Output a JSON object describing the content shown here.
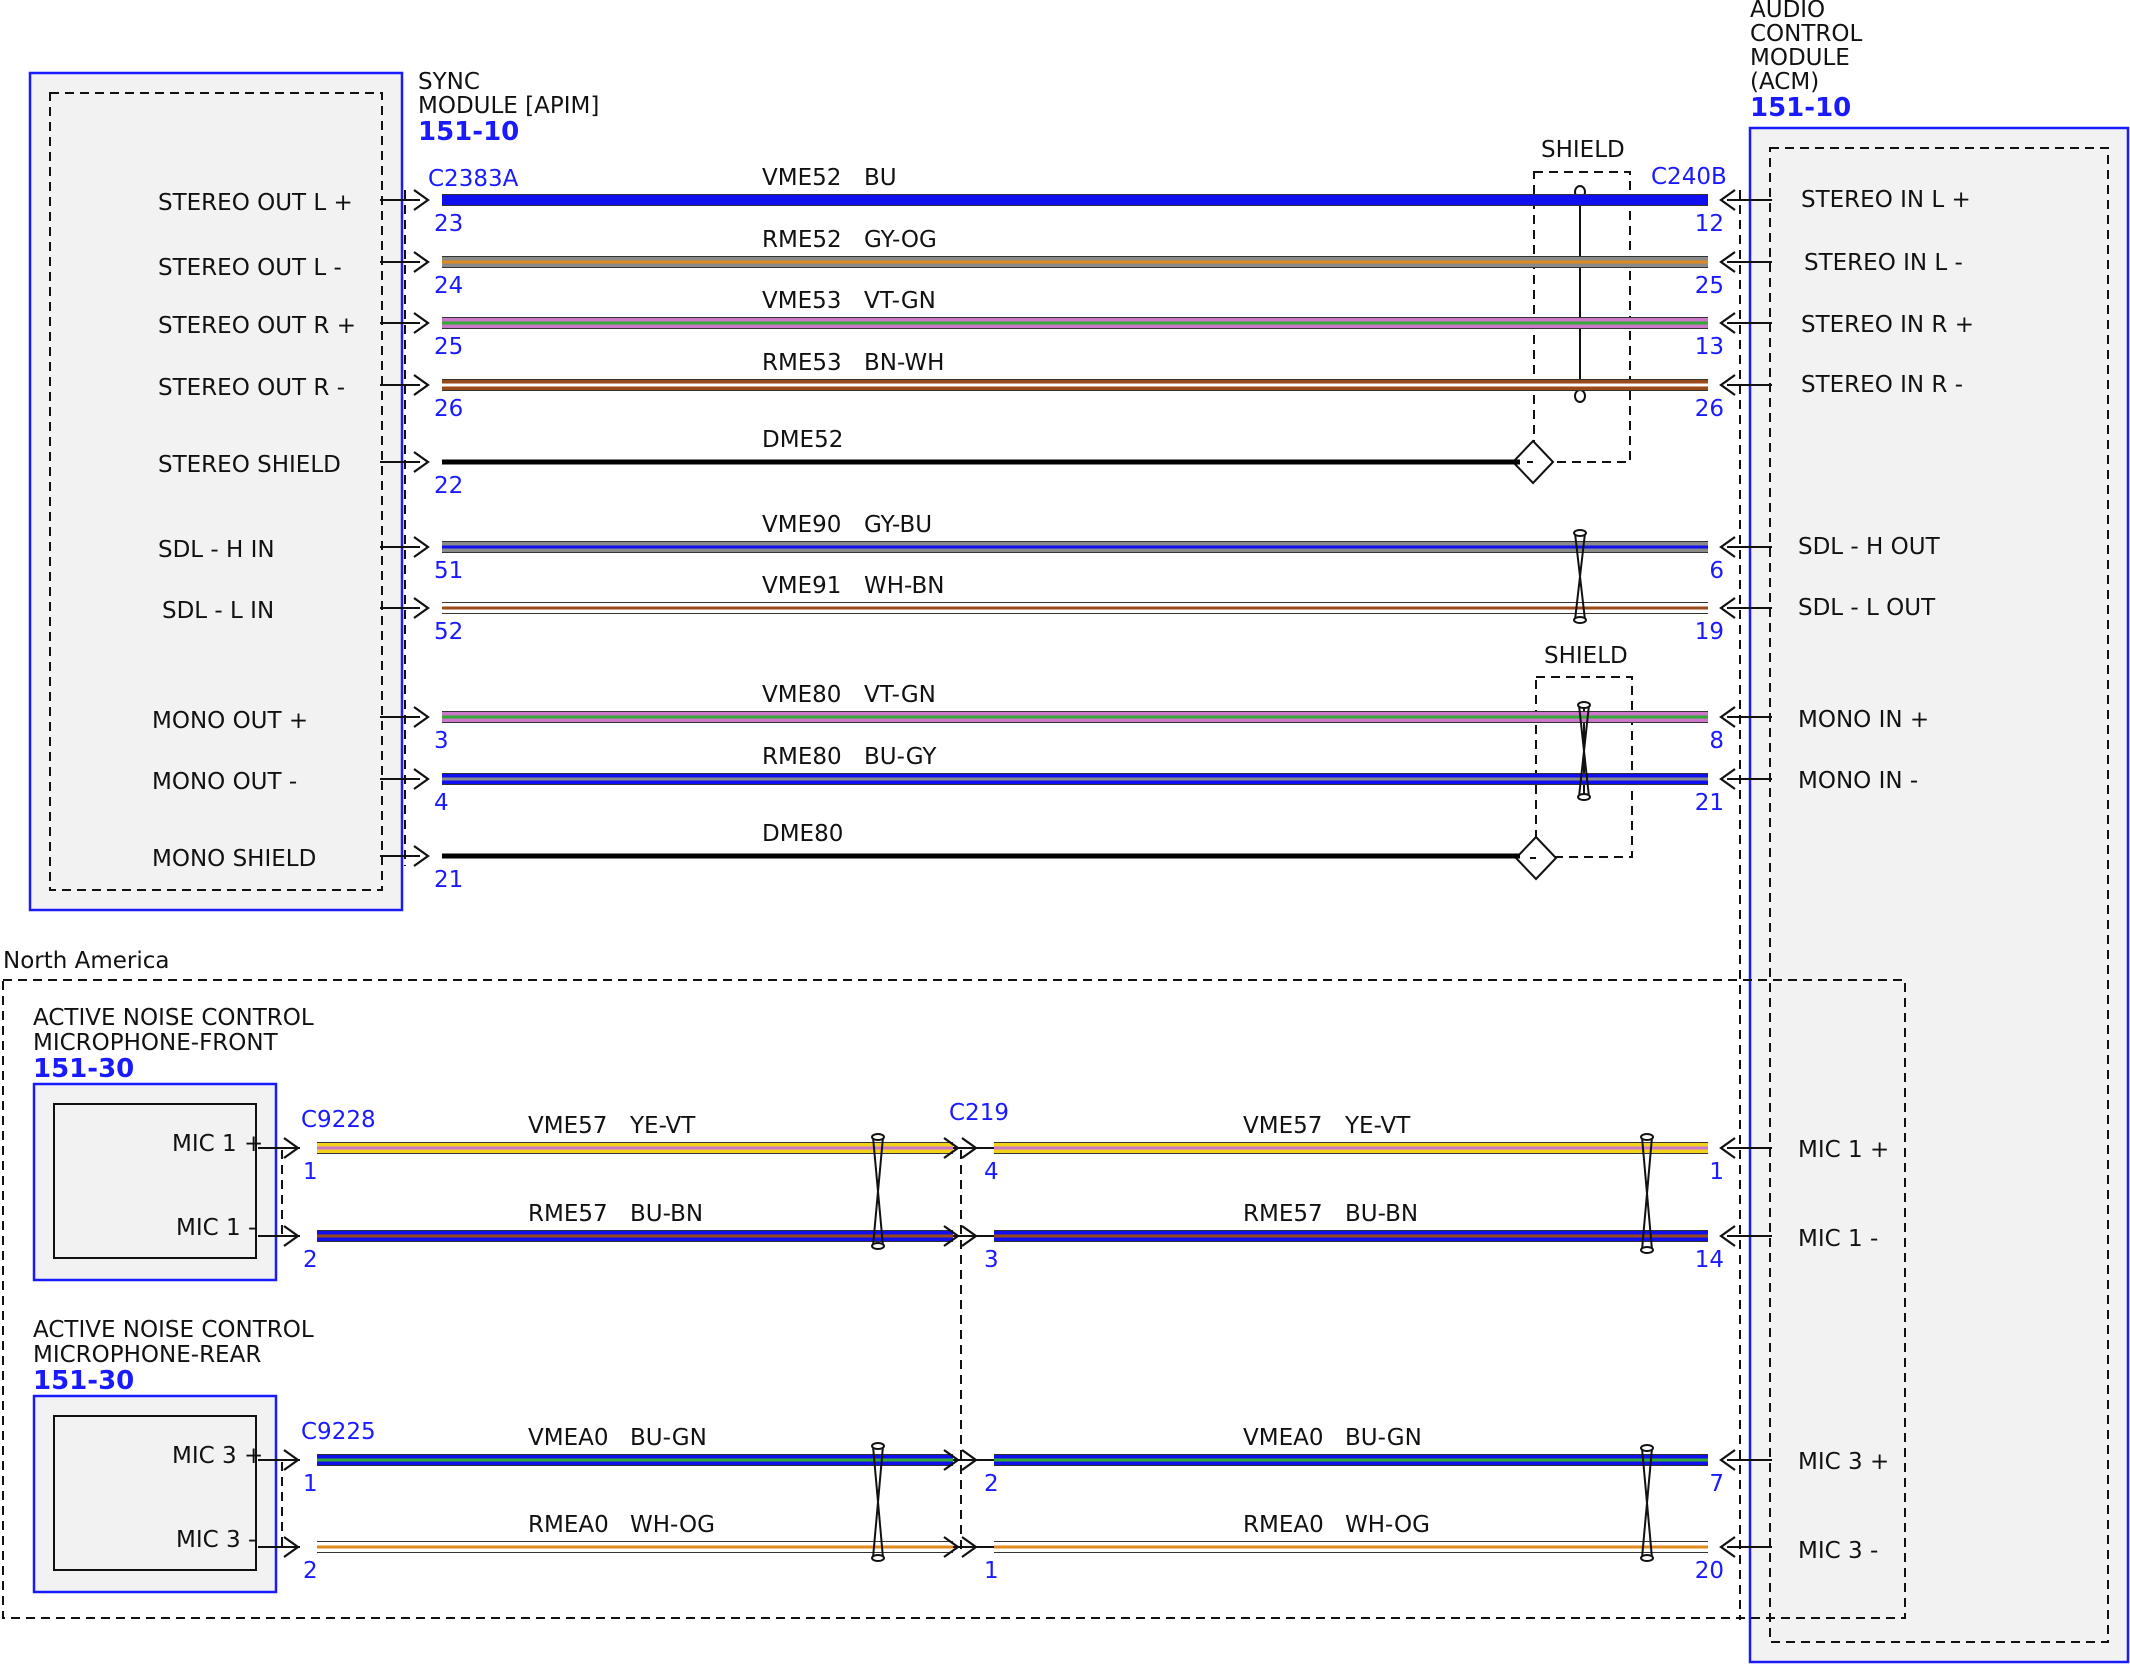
{
  "modules": {
    "sync": {
      "lines": [
        "SYNC",
        "MODULE [APIM]"
      ],
      "code": "151-10",
      "pins": [
        "STEREO OUT L +",
        "STEREO OUT L -",
        "STEREO OUT R +",
        "STEREO OUT R -",
        "STEREO SHIELD",
        "SDL - H IN",
        "SDL - L IN",
        "MONO OUT +",
        "MONO OUT -",
        "MONO SHIELD"
      ]
    },
    "acm": {
      "lines": [
        "AUDIO",
        "CONTROL",
        "MODULE",
        "(ACM)"
      ],
      "code": "151-10",
      "pins": [
        "STEREO IN L +",
        "STEREO IN L -",
        "STEREO IN R +",
        "STEREO IN R -",
        "SDL - H OUT",
        "SDL - L OUT",
        "MONO IN +",
        "MONO IN -",
        "MIC 1 +",
        "MIC 1 -",
        "MIC 3 +",
        "MIC 3 -"
      ]
    },
    "mic_front": {
      "lines": [
        "ACTIVE NOISE CONTROL",
        "MICROPHONE-FRONT"
      ],
      "code": "151-30",
      "pins": [
        "MIC 1 +",
        "MIC 1 -"
      ]
    },
    "mic_rear": {
      "lines": [
        "ACTIVE NOISE CONTROL",
        "MICROPHONE-REAR"
      ],
      "code": "151-30",
      "pins": [
        "MIC 3 +",
        "MIC 3 -"
      ]
    }
  },
  "connectors": {
    "sync": "C2383A",
    "acm": "C240B",
    "mic_front": "C9228",
    "inline": "C219",
    "mic_rear": "C9225"
  },
  "shield_label": "SHIELD",
  "region_label": "North America",
  "colors": {
    "BU": "#1010ee",
    "GY": "#8a8a8a",
    "OG": "#e08a1e",
    "VT": "#cc77cc",
    "GN": "#33aa33",
    "BN": "#9a4a18",
    "WH": "#ffffff",
    "YE": "#f2d21a",
    "BK": "#000000",
    "RD": "#d42020",
    "module_blue": "#1a1aff"
  },
  "wires": [
    {
      "circuit": "VME52",
      "color": "BU",
      "pin_left": "23",
      "pin_right": "12",
      "segment": "sync"
    },
    {
      "circuit": "RME52",
      "color": "GY-OG",
      "pin_left": "24",
      "pin_right": "25",
      "segment": "sync"
    },
    {
      "circuit": "VME53",
      "color": "VT-GN",
      "pin_left": "25",
      "pin_right": "13",
      "segment": "sync"
    },
    {
      "circuit": "RME53",
      "color": "BN-WH",
      "pin_left": "26",
      "pin_right": "26",
      "segment": "sync"
    },
    {
      "circuit": "DME52",
      "color": "",
      "pin_left": "22",
      "pin_right": "",
      "segment": "sync-drain"
    },
    {
      "circuit": "VME90",
      "color": "GY-BU",
      "pin_left": "51",
      "pin_right": "6",
      "segment": "sync"
    },
    {
      "circuit": "VME91",
      "color": "WH-BN",
      "pin_left": "52",
      "pin_right": "19",
      "segment": "sync"
    },
    {
      "circuit": "VME80",
      "color": "VT-GN",
      "pin_left": "3",
      "pin_right": "8",
      "segment": "sync"
    },
    {
      "circuit": "RME80",
      "color": "BU-GY",
      "pin_left": "4",
      "pin_right": "21",
      "segment": "sync"
    },
    {
      "circuit": "DME80",
      "color": "",
      "pin_left": "21",
      "pin_right": "",
      "segment": "sync-drain"
    },
    {
      "circuit": "VME57",
      "color": "YE-VT",
      "pin_left": "1",
      "pin_right": "4",
      "segment": "mic-left"
    },
    {
      "circuit": "VME57",
      "color": "YE-VT",
      "pin_left": "4",
      "pin_right": "1",
      "segment": "mic-right"
    },
    {
      "circuit": "RME57",
      "color": "BU-BN",
      "pin_left": "2",
      "pin_right": "3",
      "segment": "mic-left"
    },
    {
      "circuit": "RME57",
      "color": "BU-BN",
      "pin_left": "3",
      "pin_right": "14",
      "segment": "mic-right"
    },
    {
      "circuit": "VMEA0",
      "color": "BU-GN",
      "pin_left": "1",
      "pin_right": "2",
      "segment": "mic-left"
    },
    {
      "circuit": "VMEA0",
      "color": "BU-GN",
      "pin_left": "2",
      "pin_right": "7",
      "segment": "mic-right"
    },
    {
      "circuit": "RMEA0",
      "color": "WH-OG",
      "pin_left": "2",
      "pin_right": "1",
      "segment": "mic-left"
    },
    {
      "circuit": "RMEA0",
      "color": "WH-OG",
      "pin_left": "1",
      "pin_right": "20",
      "segment": "mic-right"
    }
  ]
}
